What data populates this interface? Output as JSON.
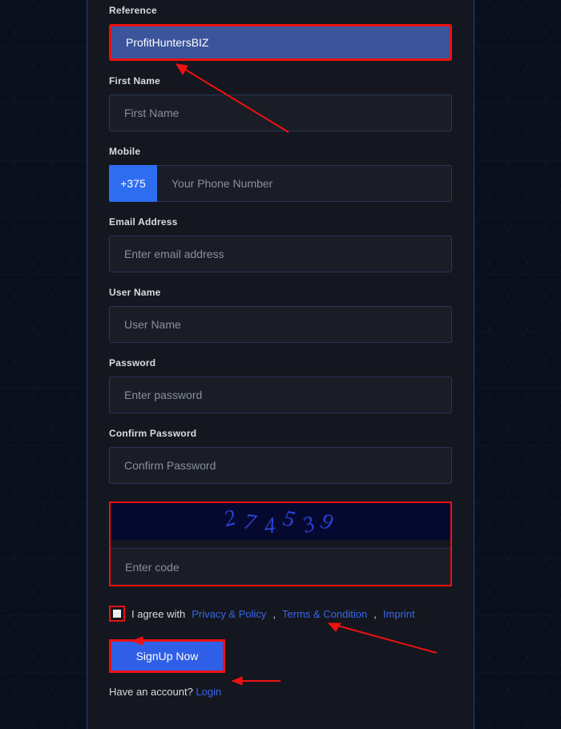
{
  "labels": {
    "reference": "Reference",
    "first_name": "First Name",
    "mobile": "Mobile",
    "email": "Email Address",
    "username": "User Name",
    "password": "Password",
    "confirm": "Confirm Password"
  },
  "values": {
    "reference": "ProfitHuntersBIZ",
    "phone_prefix": "+375"
  },
  "placeholders": {
    "first_name": "First Name",
    "phone": "Your Phone Number",
    "email": "Enter email address",
    "username": "User Name",
    "password": "Enter password",
    "confirm": "Confirm Password",
    "captcha": "Enter code"
  },
  "captcha_chars": [
    "2",
    "7",
    "4",
    "5",
    "3",
    "9"
  ],
  "agree": {
    "prefix": "I agree with",
    "privacy": "Privacy & Policy",
    "sep1": ",",
    "terms": "Terms & Condition",
    "sep2": ",",
    "imprint": "Imprint"
  },
  "buttons": {
    "signup": "SignUp Now"
  },
  "footer": {
    "have_account": "Have an account?",
    "login": "Login"
  }
}
